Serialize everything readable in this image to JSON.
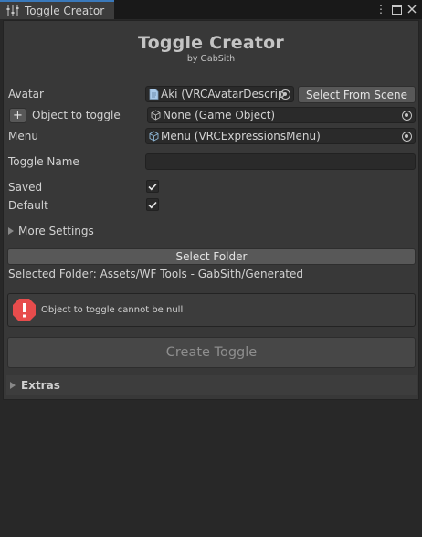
{
  "window": {
    "tab_title": "Toggle Creator",
    "tab_icon": "sliders-icon",
    "controls": [
      "more-options-icon",
      "maximize-icon",
      "close-icon"
    ]
  },
  "header": {
    "title": "Toggle Creator",
    "subtitle": "by GabSith"
  },
  "fields": {
    "avatar": {
      "label": "Avatar",
      "value": "Aki (VRCAvatarDescrip",
      "icon": "script-icon",
      "button": "Select From Scene"
    },
    "object_to_toggle": {
      "label": "Object to toggle",
      "value": "None (Game Object)",
      "icon": "cube-icon",
      "add_button": "+"
    },
    "menu": {
      "label": "Menu",
      "value": "Menu (VRCExpressionsMenu)",
      "icon": "cube-icon"
    },
    "toggle_name": {
      "label": "Toggle Name",
      "value": ""
    },
    "saved": {
      "label": "Saved",
      "checked": true
    },
    "default": {
      "label": "Default",
      "checked": true
    }
  },
  "more_settings": {
    "label": "More Settings",
    "expanded": false
  },
  "folder": {
    "button": "Select Folder",
    "selected_text": "Selected Folder: Assets/WF Tools - GabSith/Generated"
  },
  "help": {
    "icon": "error-icon",
    "message": "Object to toggle cannot be null"
  },
  "create_button": {
    "label": "Create Toggle",
    "enabled": false
  },
  "extras": {
    "label": "Extras",
    "expanded": false
  },
  "colors": {
    "background": "#282828",
    "panel": "#383838",
    "tab_accent": "#3a79bb",
    "error": "#e74c4c"
  }
}
